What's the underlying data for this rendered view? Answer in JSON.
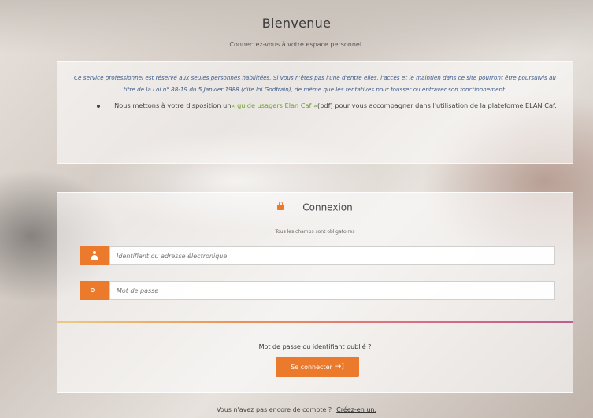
{
  "header": {
    "title": "Bienvenue",
    "subtitle": "Connectez-vous à votre espace personnel."
  },
  "info": {
    "notice": "Ce service professionnel est réservé aux seules personnes habilitées. Si vous n'êtes pas l'une d'entre elles, l'accès et le maintien dans ce site pourront être poursuivis au titre de la Loi n° 88-19 du 5 Janvier 1988 (dite loi Godfrain), de même que les tentatives pour fousser ou entraver son fonctionnement.",
    "guide_prefix": "Nous mettons à votre disposition un",
    "guide_link": "« guide usagers Elan Caf »",
    "guide_suffix": "(pdf) pour vous accompagner dans l'utilisation de la plateforme ELAN Caf."
  },
  "login": {
    "title": "Connexion",
    "required_note": "Tous les champs sont obligatoires",
    "username_placeholder": "Identifiant ou adresse électronique",
    "password_placeholder": "Mot de passe",
    "forgot_link": "Mot de passe ou identifiant oublié ?",
    "submit_label": "Se connecter",
    "submit_icon": "→]"
  },
  "signup": {
    "prompt": "Vous n'avez pas encore de compte ?",
    "link": "Créez-en un."
  },
  "icons": {
    "connexion": "lock-icon",
    "username": "user-icon",
    "password": "key-icon",
    "submit": "sign-in-icon"
  },
  "colors": {
    "accent": "#ec7a2d",
    "link_green": "#6ea02e",
    "notice_blue": "#3a5a8c"
  }
}
